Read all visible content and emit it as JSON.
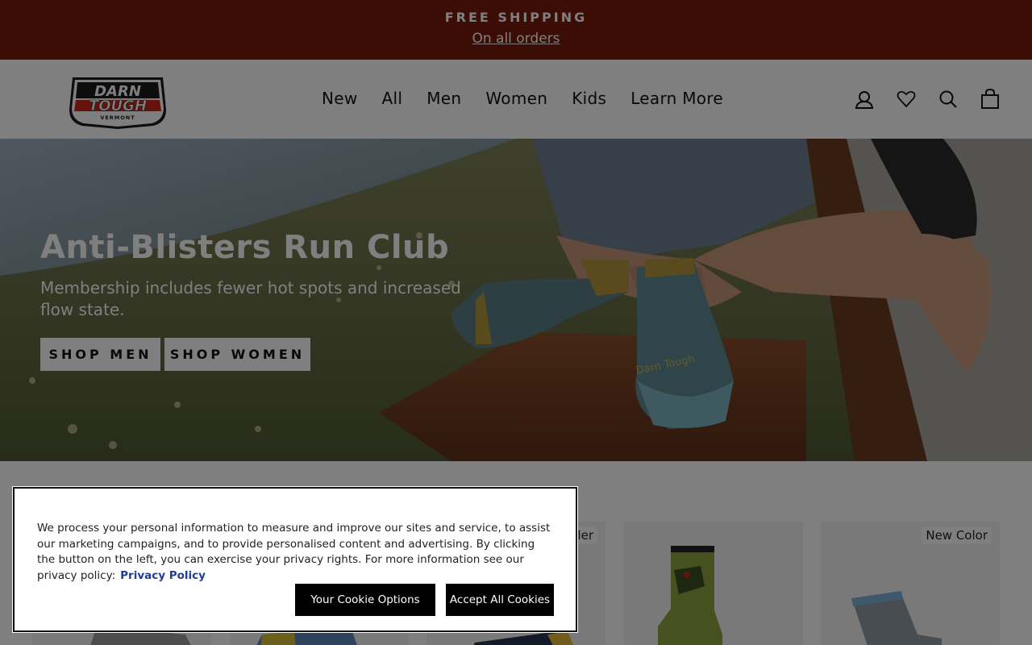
{
  "announcement": {
    "title": "FREE SHIPPING",
    "link": "On all orders"
  },
  "brand": {
    "logo_line1": "DARN",
    "logo_line2": "TOUGH",
    "logo_line3": "VERMONT"
  },
  "nav": {
    "items": [
      "New",
      "All",
      "Men",
      "Women",
      "Kids",
      "Learn More"
    ]
  },
  "header_icons": [
    "account-icon",
    "wishlist-heart-icon",
    "search-icon",
    "cart-bag-icon"
  ],
  "hero": {
    "title": "Anti-Blisters Run Club",
    "subtitle": "Membership includes fewer hot spots and increased flow state.",
    "btn_men": "SHOP MEN",
    "btn_women": "SHOP WOMEN",
    "sock_print": "Darn Tough"
  },
  "products": {
    "badges": [
      "Best Seller",
      "New Color"
    ]
  },
  "cookie": {
    "text": "We process your personal information to measure and improve our sites and service, to assist our marketing campaigns, and to provide personalised content and advertising. By clicking the button on the left, you can exercise your privacy rights. For more information see our privacy policy:",
    "policy_link": "Privacy Policy",
    "options_label": "Your Cookie Options",
    "accept_label": "Accept All Cookies"
  },
  "colors": {
    "announcement_bg": "#771a09",
    "logo_red": "#c8261b",
    "cookie_link": "#1f3d96"
  }
}
